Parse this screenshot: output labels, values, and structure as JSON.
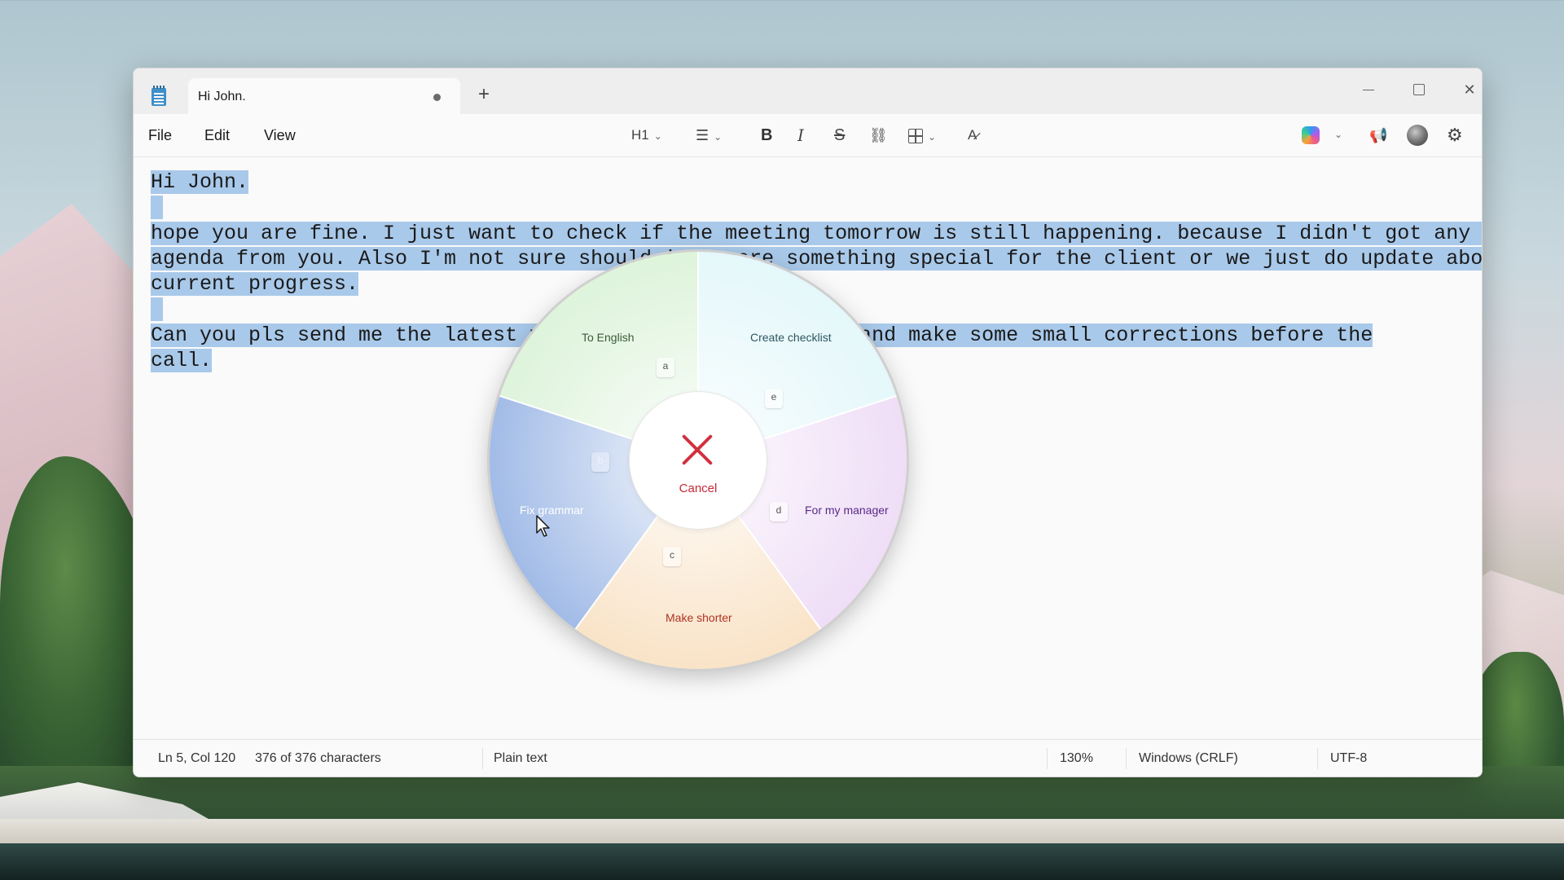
{
  "window": {
    "tab_title": "Hi John.",
    "new_tab_label": "+",
    "close_label": "✕"
  },
  "menu": {
    "file": "File",
    "edit": "Edit",
    "view": "View"
  },
  "toolbar": {
    "heading": "H1",
    "list_icon": "☰",
    "bold": "B",
    "italic": "I",
    "strike": "S",
    "link_icon": "⛓",
    "clear_format_icon": "A̷",
    "announce_icon": "📢",
    "settings_icon": "⚙",
    "chevron": "⌄",
    "accent_color": "#3f8fc9"
  },
  "document": {
    "lines": [
      "Hi John.",
      " ",
      "hope you are fine. I just want to check if the meeting tomorrow is still happening. because I didn't got any final",
      "agenda from you. Also I'm not sure should i prepare something special for the client or we just do update about",
      "current progress.",
      " ",
      "Can you pls send me the latest version so I can review it and make some small corrections before the",
      "call."
    ],
    "selection_color": "#a9c9ea"
  },
  "radial_menu": {
    "center_label": "Cancel",
    "segments": {
      "to_english": {
        "label": "To English",
        "key": "a"
      },
      "create_checklist": {
        "label": "Create checklist",
        "key": "e"
      },
      "for_my_manager": {
        "label": "For my manager",
        "key": "d"
      },
      "make_shorter": {
        "label": "Make shorter",
        "key": "c"
      },
      "fix_grammar": {
        "label": "Fix grammar",
        "key": "b"
      }
    }
  },
  "status": {
    "position": "Ln 5, Col 120",
    "characters": "376 of 376 characters",
    "format": "Plain text",
    "zoom": "130%",
    "line_ending": "Windows (CRLF)",
    "encoding": "UTF-8"
  }
}
